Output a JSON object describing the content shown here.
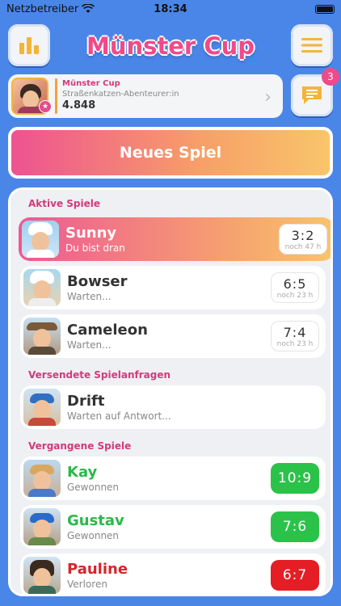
{
  "status_bar": {
    "carrier": "Netzbetreiber",
    "time": "18:34"
  },
  "header": {
    "title": "Münster Cup"
  },
  "profile": {
    "cup": "Münster Cup",
    "subtitle": "Straßenkatzen-Abenteurer:in",
    "points": "4.848"
  },
  "messages": {
    "badge": "3"
  },
  "new_game": {
    "label": "Neues Spiel"
  },
  "sections": {
    "active": "Aktive Spiele",
    "sent": "Versendete Spielanfragen",
    "past": "Vergangene Spiele"
  },
  "active_games": [
    {
      "name": "Sunny",
      "status": "Du bist dran",
      "score": "3:2",
      "remaining": "noch 47 h"
    },
    {
      "name": "Bowser",
      "status": "Warten...",
      "score": "6:5",
      "remaining": "noch 23 h"
    },
    {
      "name": "Cameleon",
      "status": "Warten...",
      "score": "7:4",
      "remaining": "noch 23 h"
    }
  ],
  "sent_requests": [
    {
      "name": "Drift",
      "status": "Warten auf Antwort..."
    }
  ],
  "past_games": [
    {
      "name": "Kay",
      "status": "Gewonnen",
      "score": "10:9"
    },
    {
      "name": "Gustav",
      "status": "Gewonnen",
      "score": "7:6"
    },
    {
      "name": "Pauline",
      "status": "Verloren",
      "score": "6:7"
    }
  ],
  "icons": {
    "stats": "bar-chart-icon",
    "menu": "hamburger-menu-icon",
    "messages": "chat-bubble-icon",
    "trophy": "trophy-icon",
    "wifi": "wifi-icon",
    "battery": "battery-icon",
    "chevron": "chevron-right-icon"
  },
  "colors": {
    "background": "#4a86e8",
    "accent_pink": "#f04a8a",
    "accent_orange": "#f3a23a",
    "win": "#2bc24a",
    "lose": "#e41e24"
  }
}
